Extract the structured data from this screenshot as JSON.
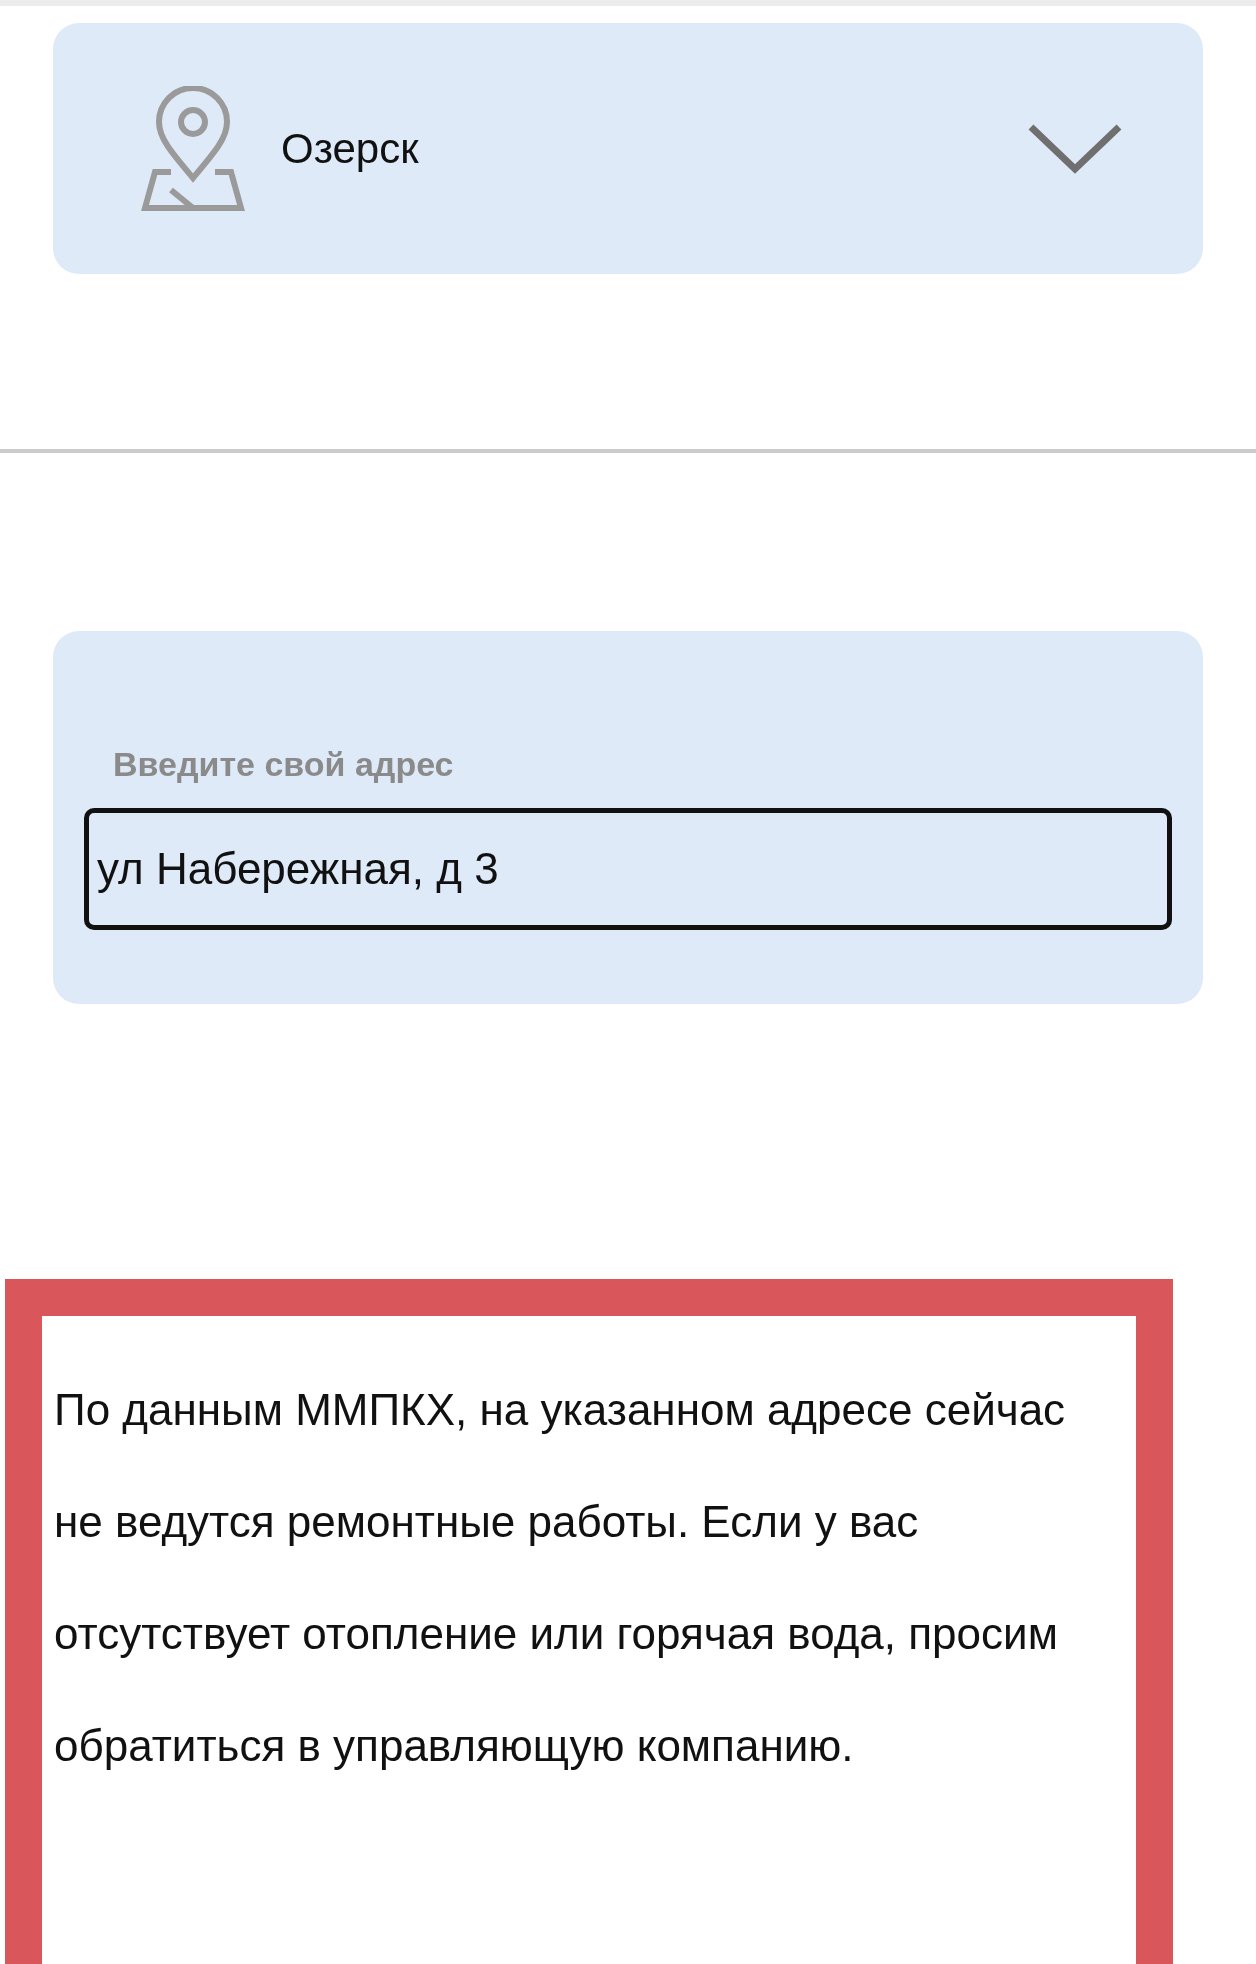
{
  "city_selector": {
    "value": "Озерск"
  },
  "address_form": {
    "label": "Введите свой адрес",
    "value": "ул Набережная, д 3"
  },
  "notice": {
    "text": "По данным ММПКХ, на указанном адресе сейчас не ведутся ремонтные работы. Если у вас отсутствует отопление или горячая вода, просим обратиться в управляющую компанию."
  }
}
